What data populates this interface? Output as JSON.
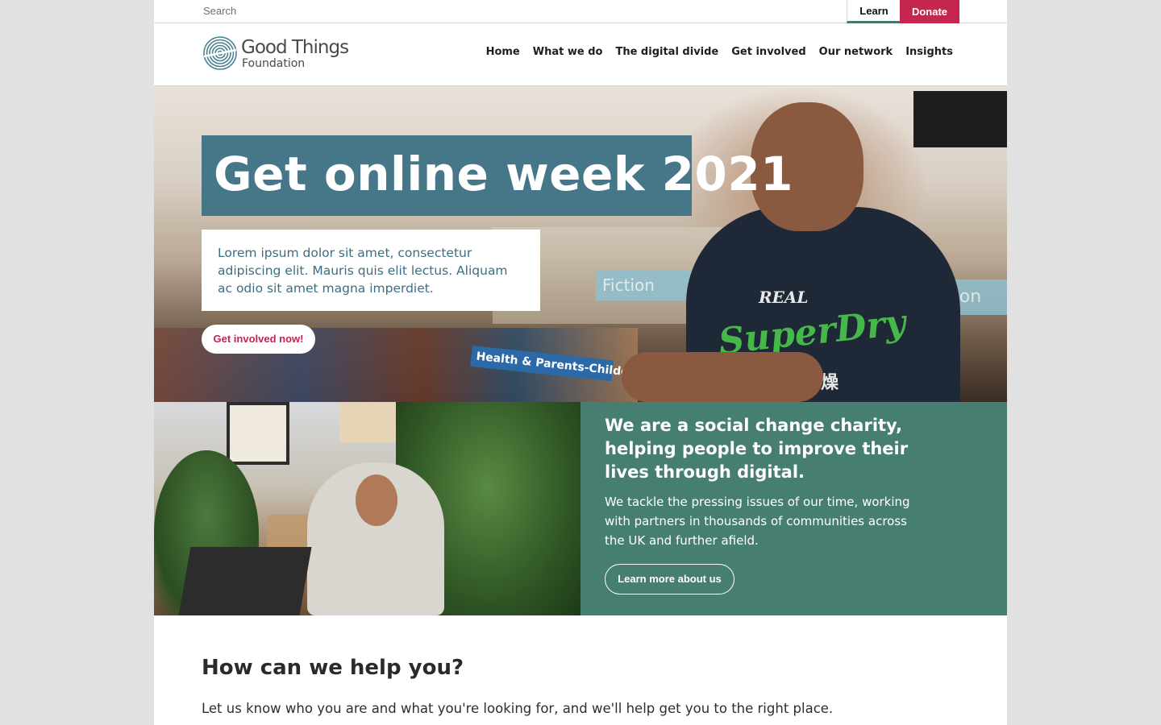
{
  "utility": {
    "search_placeholder": "Search",
    "learn_label": "Learn",
    "donate_label": "Donate"
  },
  "brand": {
    "name": "Good Things",
    "sub": "Foundation",
    "logo_icon": "fingerprint-icon"
  },
  "nav": {
    "items": [
      "Home",
      "What we do",
      "The digital divide",
      "Get involved",
      "Our network",
      "Insights"
    ]
  },
  "hero": {
    "title": "Get online week 2021",
    "text": "Lorem ipsum dolor sit amet, consectetur adipiscing elit. Mauris quis elit lectus. Aliquam ac odio sit amet magna imperdiet.",
    "cta": "Get involved now!",
    "photo_signs": {
      "sign": "Health & Parents-Childcare",
      "fiction_left": "Fiction",
      "fiction_right": "tion",
      "shirt_line1": "REAL",
      "shirt_line2": "SuperDry",
      "shirt_line3": "极度乾燥"
    }
  },
  "about": {
    "heading": "We are a social change charity, helping people to improve their lives through digital.",
    "text": "We tackle the pressing issues of our time, working with partners in thousands of communities across the UK and further afield.",
    "cta": "Learn more about us"
  },
  "help": {
    "title": "How can we help you?",
    "text": "Let us know who you are and what you're looking for, and we'll help get you to the right place."
  },
  "colors": {
    "teal_blue": "#457788",
    "green": "#477e72",
    "donate": "#c6264d",
    "cta_text": "#bf2650"
  }
}
